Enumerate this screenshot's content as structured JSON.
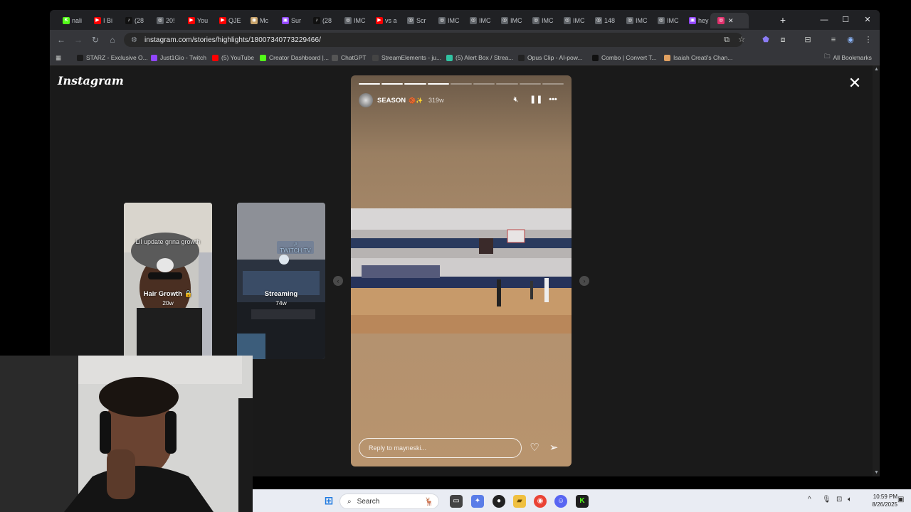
{
  "browser": {
    "tabs": [
      {
        "label": "nali",
        "fav": "K",
        "color": "#53fc18"
      },
      {
        "label": "I Bi",
        "fav": "▶",
        "color": "#ff0000"
      },
      {
        "label": "(28",
        "fav": "♪",
        "color": "#111111"
      },
      {
        "label": "20!",
        "fav": "◎",
        "color": "#5f6368"
      },
      {
        "label": "You",
        "fav": "▶",
        "color": "#ff0000"
      },
      {
        "label": "QJE",
        "fav": "▶",
        "color": "#ff0000"
      },
      {
        "label": "Mc",
        "fav": "◉",
        "color": "#c8a36b"
      },
      {
        "label": "Sur",
        "fav": "▣",
        "color": "#9146ff"
      },
      {
        "label": "(28",
        "fav": "♪",
        "color": "#111111"
      },
      {
        "label": "IMC",
        "fav": "◎",
        "color": "#5f6368"
      },
      {
        "label": "vs a",
        "fav": "▶",
        "color": "#ff0000"
      },
      {
        "label": "Scr",
        "fav": "◎",
        "color": "#5f6368"
      },
      {
        "label": "IMC",
        "fav": "◎",
        "color": "#5f6368"
      },
      {
        "label": "IMC",
        "fav": "◎",
        "color": "#5f6368"
      },
      {
        "label": "IMC",
        "fav": "◎",
        "color": "#5f6368"
      },
      {
        "label": "IMC",
        "fav": "◎",
        "color": "#5f6368"
      },
      {
        "label": "IMC",
        "fav": "◎",
        "color": "#5f6368"
      },
      {
        "label": "148",
        "fav": "◎",
        "color": "#5f6368"
      },
      {
        "label": "IMC",
        "fav": "◎",
        "color": "#5f6368"
      },
      {
        "label": "IMC",
        "fav": "◎",
        "color": "#5f6368"
      },
      {
        "label": "hey",
        "fav": "▣",
        "color": "#9146ff"
      }
    ],
    "active_tab": {
      "fav": "◎",
      "color": "#e1306c"
    },
    "url": "instagram.com/stories/highlights/18007340773229466/",
    "bookmarks": [
      {
        "label": "STARZ - Exclusive O...",
        "color": "#1b1b1b"
      },
      {
        "label": "Just1Gio - Twitch",
        "color": "#9146ff"
      },
      {
        "label": "(5) YouTube",
        "color": "#ff0000"
      },
      {
        "label": "Creator Dashboard |...",
        "color": "#53fc18"
      },
      {
        "label": "ChatGPT",
        "color": "#555555"
      },
      {
        "label": "StreamElements - ju...",
        "color": "#444444"
      },
      {
        "label": "(5) Alert Box / Strea...",
        "color": "#31c3a2"
      },
      {
        "label": "Opus Clip - AI-pow...",
        "color": "#222222"
      },
      {
        "label": "Combo | Convert T...",
        "color": "#111111"
      },
      {
        "label": "Isaiah Creati's Chan...",
        "color": "#e0a060"
      }
    ],
    "all_bookmarks": "All Bookmarks"
  },
  "instagram": {
    "logo": "Instagram",
    "previews": [
      {
        "overlay": "Lil update gnna growth",
        "title": "Hair Growth 🔒",
        "age": "20w"
      },
      {
        "overlay": "⇗ TWITCH.TV",
        "title": "Streaming",
        "age": "74w"
      }
    ],
    "story": {
      "segments_total": 9,
      "segments_done": 4,
      "username": "SEASON",
      "emoji": "🏀✨",
      "time": "319w",
      "reply_placeholder": "Reply to mayneski..."
    }
  },
  "taskbar": {
    "search_label": "Search",
    "time": "10:59 PM",
    "date": "8/26/2025"
  }
}
